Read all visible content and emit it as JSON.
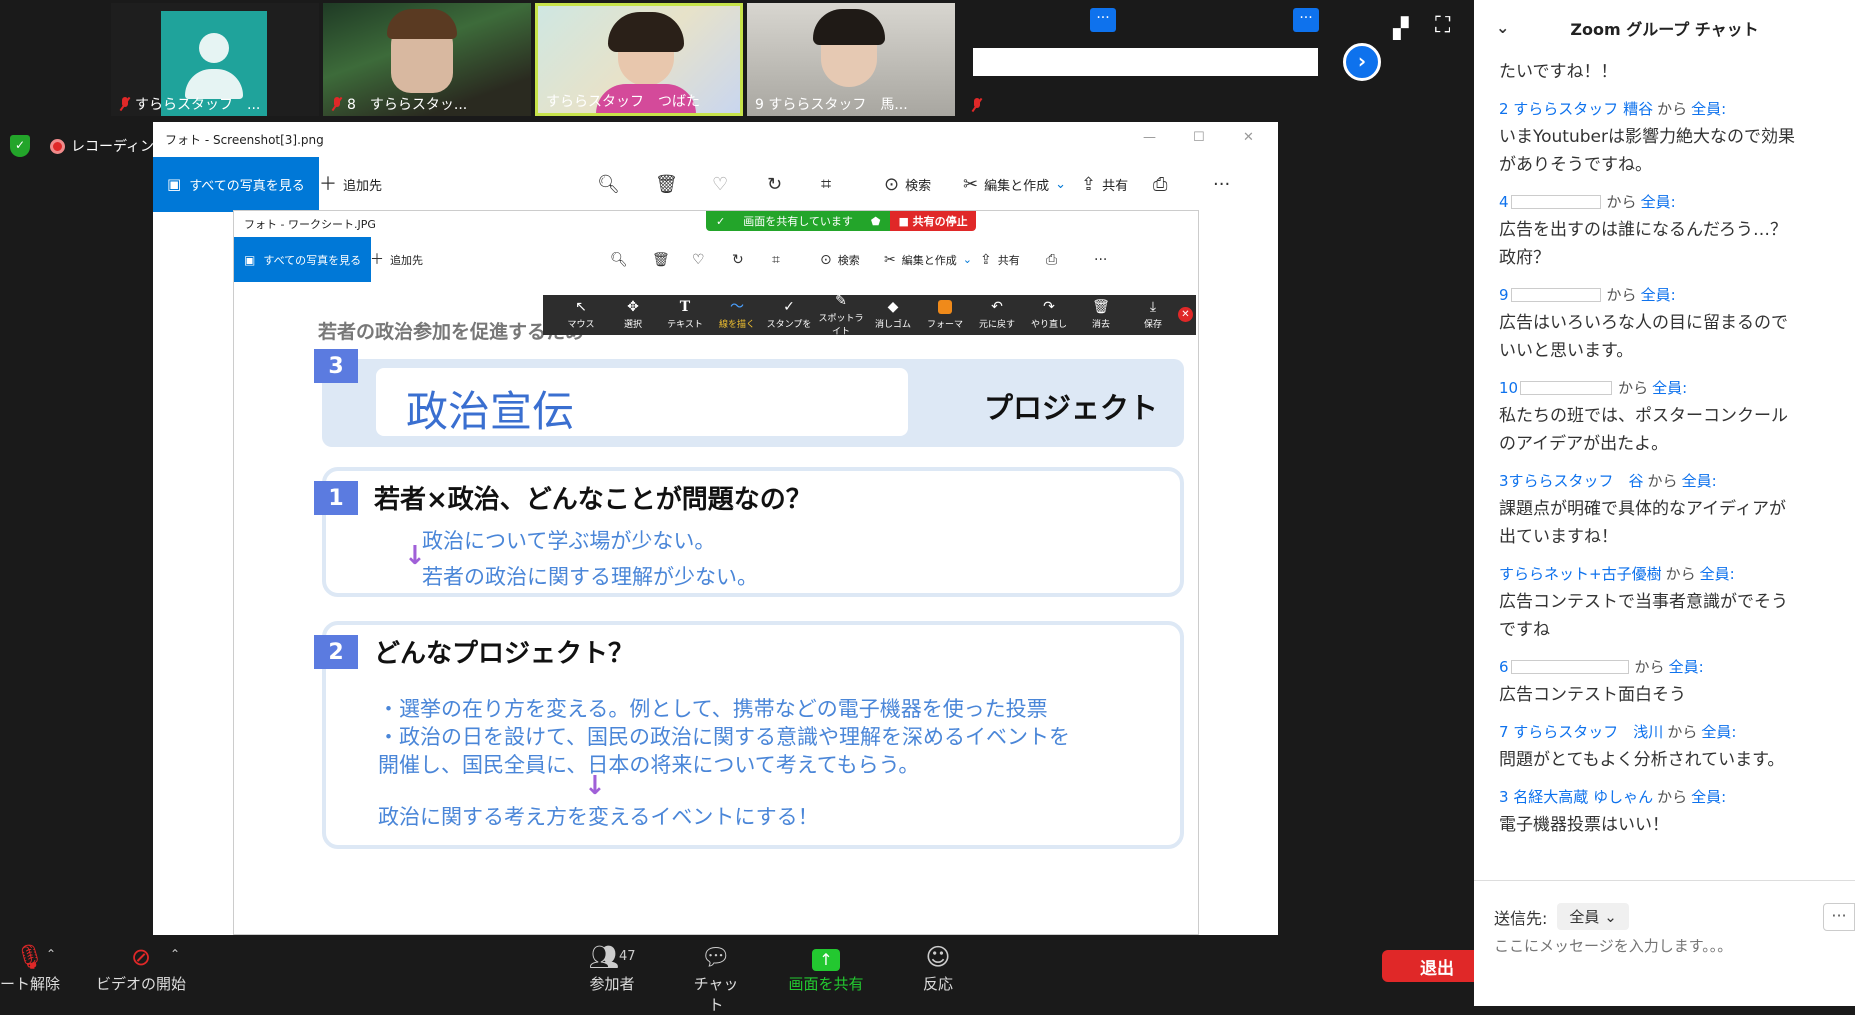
{
  "video_tiles": [
    {
      "name": "すららスタッフ　..."
    },
    {
      "name": "8　すららスタッ..."
    },
    {
      "name": "すららスタッフ　つばた"
    },
    {
      "name": "9 すららスタッフ　馬..."
    }
  ],
  "recording": {
    "label": "レコーディング"
  },
  "more_label": "···",
  "photos_window": {
    "title": "フォト - Screenshot[3].png",
    "all_photos": "すべての写真を見る",
    "add_to": "追加先",
    "search": "検索",
    "edit_create": "編集と作成",
    "share": "共有"
  },
  "inner_window": {
    "title": "フォト - ワークシート.JPG",
    "all_photos": "すべての写真を見る",
    "add_to": "追加先",
    "search": "検索",
    "edit_create": "編集と作成",
    "share": "共有"
  },
  "share_status": {
    "sharing": "画面を共有しています",
    "stop": "■ 共有の停止"
  },
  "annotation_tools": [
    "マウス",
    "選択",
    "テキスト",
    "線を描く",
    "スタンプを",
    "スポットライト",
    "消しゴム",
    "フォーマ",
    "元に戻す",
    "やり直し",
    "消去",
    "保存"
  ],
  "worksheet": {
    "header": "若者の政治参加を促進するため",
    "num3": "3",
    "title": "政治宣伝",
    "project": "プロジェクト",
    "num1": "1",
    "q1": "若者×政治、どんなことが問題なの？",
    "a1_1": "政治について学ぶ場が少ない。",
    "a1_2": "若者の政治に関する理解が少ない。",
    "num2": "2",
    "q2": "どんなプロジェクト？",
    "a2_1": "・選挙の在り方を変える。例として、携帯などの電子機器を使った投票",
    "a2_2": "・政治の日を設けて、国民の政治に関する意識や理解を深めるイベントを",
    "a2_3": "開催し、国民全員に、日本の将来について考えてもらう。",
    "a2_4": "政治に関する考え方を変えるイベントにする！"
  },
  "bottom_bar": {
    "unmute": "ート解除",
    "video": "ビデオの開始",
    "participants": "参加者",
    "participant_count": "47",
    "chat": "チャット",
    "share_screen": "画面を共有",
    "reactions": "反応",
    "leave": "退出"
  },
  "chat": {
    "title": "Zoom グループ チャット",
    "from_word": "から",
    "to_word": "全員:",
    "first_line": "たいですね！！",
    "messages": [
      {
        "sender": "2 すららスタッフ 糟谷",
        "text": "いまYoutuberは影響力絶大なので効果\nがありそうですね。"
      },
      {
        "sender": "4",
        "text": "広告を出すのは誰になるんだろう…？\n政府？"
      },
      {
        "sender": "9",
        "text": "広告はいろいろな人の目に留まるので\nいいと思います。"
      },
      {
        "sender": "10",
        "text": "私たちの班では、ポスターコンクール\nのアイデアが出たよ。"
      },
      {
        "sender": "3すららスタッフ　谷",
        "text": "課題点が明確で具体的なアイディアが\n出ていますね！"
      },
      {
        "sender": "すららネット+古子優樹",
        "text": "広告コンテストで当事者意識がでそう\nですね"
      },
      {
        "sender": "6",
        "text": "広告コンテスト面白そう"
      },
      {
        "sender": "7 すららスタッフ　浅川",
        "text": "問題がとてもよく分析されています。"
      },
      {
        "sender": "3 名経大高蔵 ゆしゃん",
        "text": "電子機器投票はいい！"
      }
    ],
    "send_to_label": "送信先:",
    "send_to_value": "全員",
    "input_placeholder": "ここにメッセージを入力します。。。"
  }
}
